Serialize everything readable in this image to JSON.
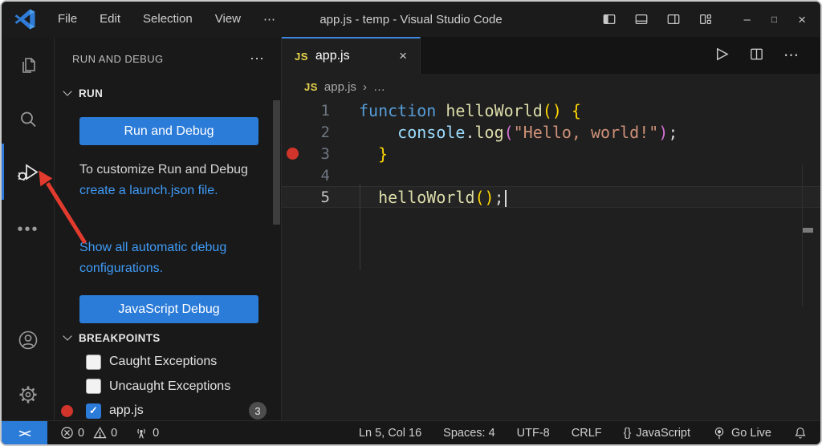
{
  "colors": {
    "accent_blue": "#2b7bd9",
    "tab_active_border": "#3b87dd",
    "link_blue": "#3f9bf7",
    "breakpoint_red": "#d1342a",
    "arrow_red": "#e23b2e",
    "js_icon_yellow": "#e8d44d",
    "keyword_blue": "#569cd6",
    "function_yellow": "#dcdcaa",
    "string_orange": "#ce9178",
    "bracket_gold": "#ffd602",
    "bracket_purple": "#d670d6"
  },
  "titlebar": {
    "menus": [
      "File",
      "Edit",
      "Selection",
      "View"
    ],
    "menu_more": "⋯",
    "title": "app.js - temp - Visual Studio Code",
    "window_controls": {
      "minimize": "–",
      "maximize": "□",
      "close": "×"
    }
  },
  "sidebar": {
    "title": "RUN AND DEBUG",
    "more": "⋯",
    "run": {
      "header": "RUN",
      "run_button": "Run and Debug",
      "hint_text": "To customize Run and Debug ",
      "hint_link": "create a launch.json file.",
      "show_link": "Show all automatic debug configurations.",
      "js_debug_button": "JavaScript Debug"
    },
    "breakpoints": {
      "header": "BREAKPOINTS",
      "check_glyph": "✓",
      "items": [
        {
          "label": "Caught Exceptions",
          "checked": false
        },
        {
          "label": "Uncaught Exceptions",
          "checked": false
        },
        {
          "label": "app.js",
          "checked": true,
          "badge": "3"
        }
      ]
    }
  },
  "editor": {
    "tab": {
      "icon": "JS",
      "label": "app.js",
      "close": "×"
    },
    "actions_more": "⋯",
    "breadcrumb": {
      "icon": "JS",
      "file": "app.js",
      "separator": "›",
      "more": "…"
    },
    "code": {
      "line_numbers": [
        "1",
        "2",
        "3",
        "4",
        "5"
      ],
      "lines": [
        [
          "function",
          " helloWorld",
          "()",
          " {"
        ],
        [
          "    console",
          ".",
          "log",
          "(",
          "\"Hello, world!\"",
          ")",
          ";"
        ],
        [
          "  }"
        ],
        [
          ""
        ],
        [
          "  helloWorld",
          "()",
          ";"
        ]
      ]
    }
  },
  "status_bar": {
    "remote_label": "><",
    "errors": "0",
    "warnings": "0",
    "ports": "0",
    "cursor_position": "Ln 5, Col 16",
    "indentation": "Spaces: 4",
    "encoding": "UTF-8",
    "eol": "CRLF",
    "language_icon": "{}",
    "language": "JavaScript",
    "go_live": "Go Live"
  }
}
